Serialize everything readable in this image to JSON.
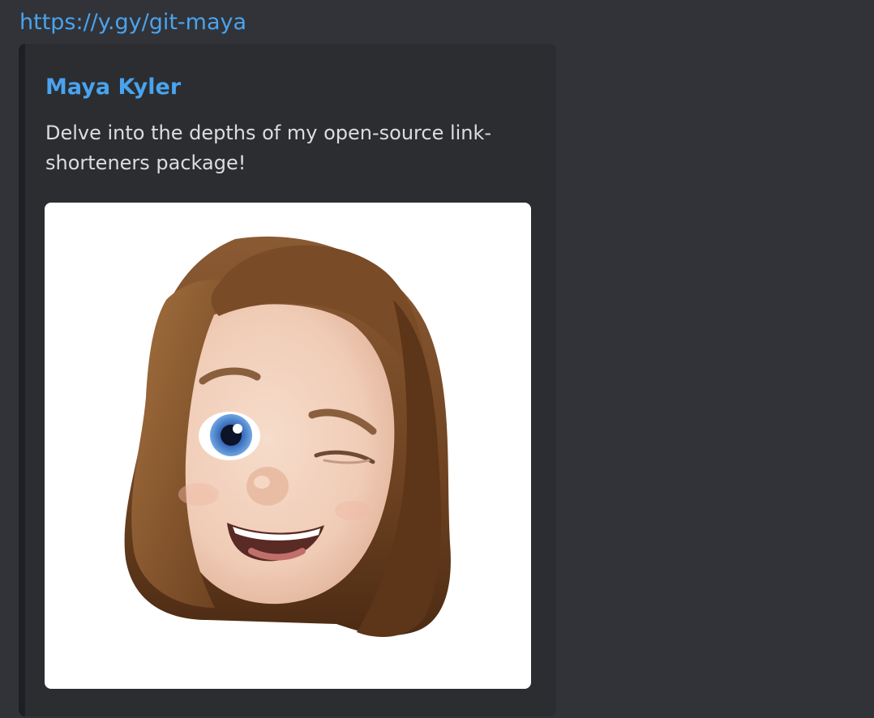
{
  "message": {
    "link_text": "https://y.gy/git-maya"
  },
  "embed": {
    "author": "Maya Kyler",
    "description": "Delve into the depths of my open-source link-shorteners package!",
    "image_icon": "memoji-avatar-winking-icon"
  },
  "colors": {
    "background": "#313338",
    "embed_background": "#2b2d31",
    "link": "#4aa3ee",
    "text": "#dbdee1"
  }
}
